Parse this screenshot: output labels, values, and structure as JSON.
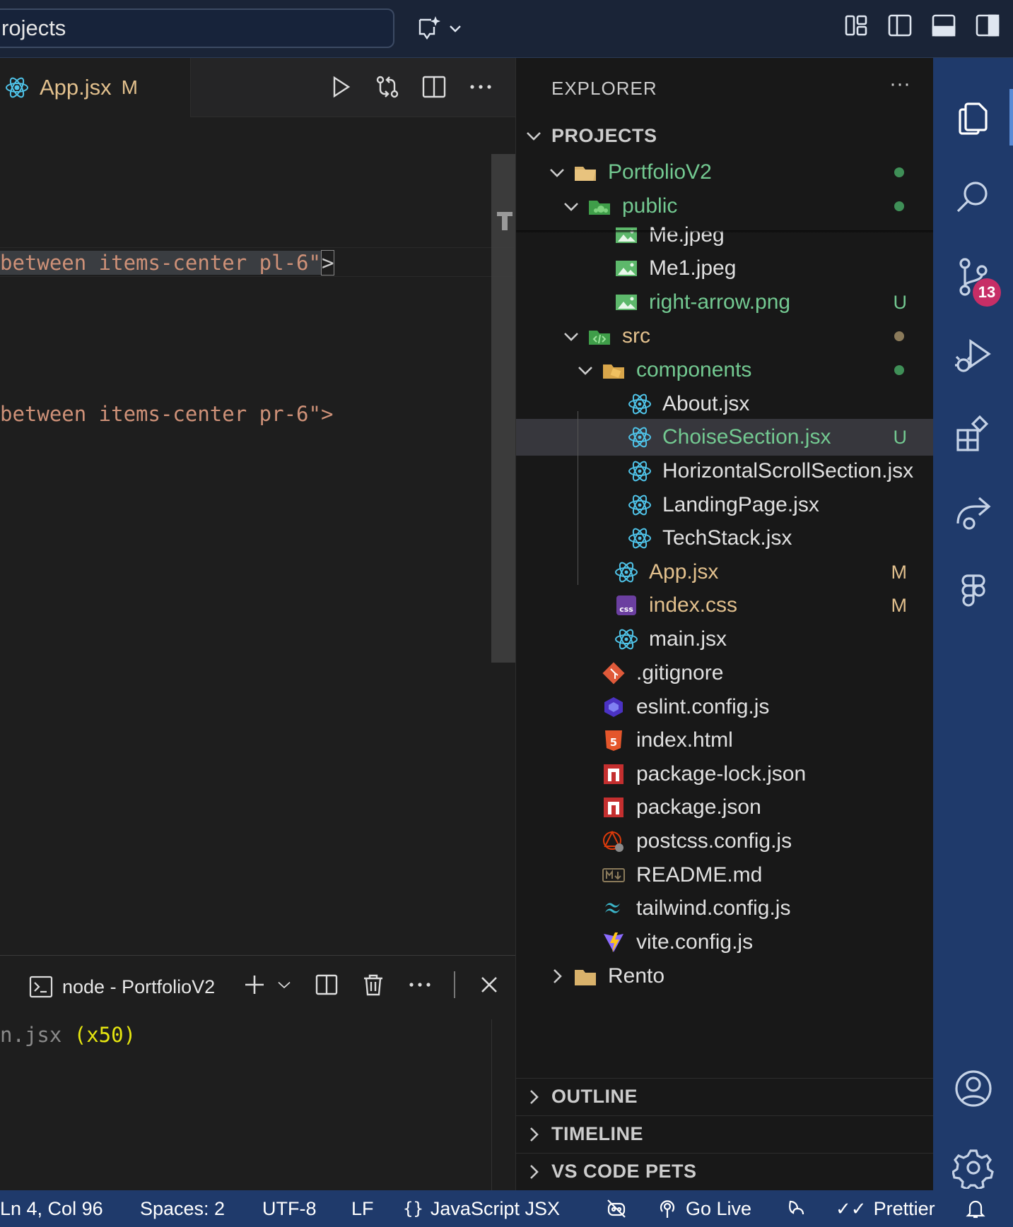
{
  "titlebar": {
    "search_text": "rojects"
  },
  "editor": {
    "tab": {
      "name": "App.jsx",
      "status": "M"
    },
    "code_lines": [
      {
        "highlighted": "between items-center pl-6\"",
        "rest": ">"
      },
      {
        "highlighted": "",
        "rest": "between items-center pr-6\">"
      }
    ]
  },
  "panel": {
    "terminal_tab": "node - PortfolioV2",
    "line_file": "n.jsx ",
    "line_count": "(x50)"
  },
  "sidebar": {
    "title": "EXPLORER",
    "more": "···",
    "projects_header": "PROJECTS",
    "tree": [
      {
        "label": "PortfolioV2",
        "color": "#73c991",
        "dot": "#3f8f57",
        "icon": "folder-open-icon"
      },
      {
        "label": "public",
        "color": "#73c991",
        "dot": "#3f8f57",
        "icon": "public-folder-icon"
      },
      {
        "label": "Me.jpeg",
        "color": "#e0e0e0",
        "icon": "image-icon"
      },
      {
        "label": "Me1.jpeg",
        "color": "#e0e0e0",
        "icon": "image-icon"
      },
      {
        "label": "right-arrow.png",
        "color": "#73c991",
        "badge": "U",
        "icon": "image-icon"
      },
      {
        "label": "src",
        "color": "#e2c08d",
        "dot": "#8a7a5a",
        "icon": "src-folder-icon"
      },
      {
        "label": "components",
        "color": "#73c991",
        "dot": "#3f8f57",
        "icon": "components-folder-icon"
      },
      {
        "label": "About.jsx",
        "color": "#e0e0e0",
        "icon": "react-icon"
      },
      {
        "label": "ChoiseSection.jsx",
        "color": "#73c991",
        "badge": "U",
        "icon": "react-icon"
      },
      {
        "label": "HorizontalScrollSection.jsx",
        "color": "#e0e0e0",
        "icon": "react-icon"
      },
      {
        "label": "LandingPage.jsx",
        "color": "#e0e0e0",
        "icon": "react-icon"
      },
      {
        "label": "TechStack.jsx",
        "color": "#e0e0e0",
        "icon": "react-icon"
      },
      {
        "label": "App.jsx",
        "color": "#e2c08d",
        "badge": "M",
        "icon": "react-icon"
      },
      {
        "label": "index.css",
        "color": "#e2c08d",
        "badge": "M",
        "icon": "css-icon"
      },
      {
        "label": "main.jsx",
        "color": "#e0e0e0",
        "icon": "react-icon"
      },
      {
        "label": ".gitignore",
        "color": "#e0e0e0",
        "icon": "git-icon"
      },
      {
        "label": "eslint.config.js",
        "color": "#e0e0e0",
        "icon": "eslint-icon"
      },
      {
        "label": "index.html",
        "color": "#e0e0e0",
        "icon": "html-icon"
      },
      {
        "label": "package-lock.json",
        "color": "#e0e0e0",
        "icon": "npm-icon"
      },
      {
        "label": "package.json",
        "color": "#e0e0e0",
        "icon": "npm-icon"
      },
      {
        "label": "postcss.config.js",
        "color": "#e0e0e0",
        "icon": "postcss-icon"
      },
      {
        "label": "README.md",
        "color": "#e0e0e0",
        "icon": "markdown-icon"
      },
      {
        "label": "tailwind.config.js",
        "color": "#e0e0e0",
        "icon": "tailwind-icon"
      },
      {
        "label": "vite.config.js",
        "color": "#e0e0e0",
        "icon": "vite-icon"
      },
      {
        "label": "Rento",
        "color": "#e0e0e0",
        "icon": "folder-icon"
      }
    ],
    "sections": [
      "OUTLINE",
      "TIMELINE",
      "VS CODE PETS"
    ]
  },
  "activity": {
    "scm_badge": "13"
  },
  "statusbar": {
    "position": "Ln 4, Col 96",
    "spaces": "Spaces: 2",
    "encoding": "UTF-8",
    "eol": "LF",
    "language": "JavaScript JSX",
    "golive": "Go Live",
    "prettier": "Prettier"
  },
  "colors": {
    "accent": "#1f3a6b",
    "git_untracked": "#73c991",
    "git_modified": "#e2c08d",
    "string": "#ce9178",
    "badge": "#c72e66"
  }
}
